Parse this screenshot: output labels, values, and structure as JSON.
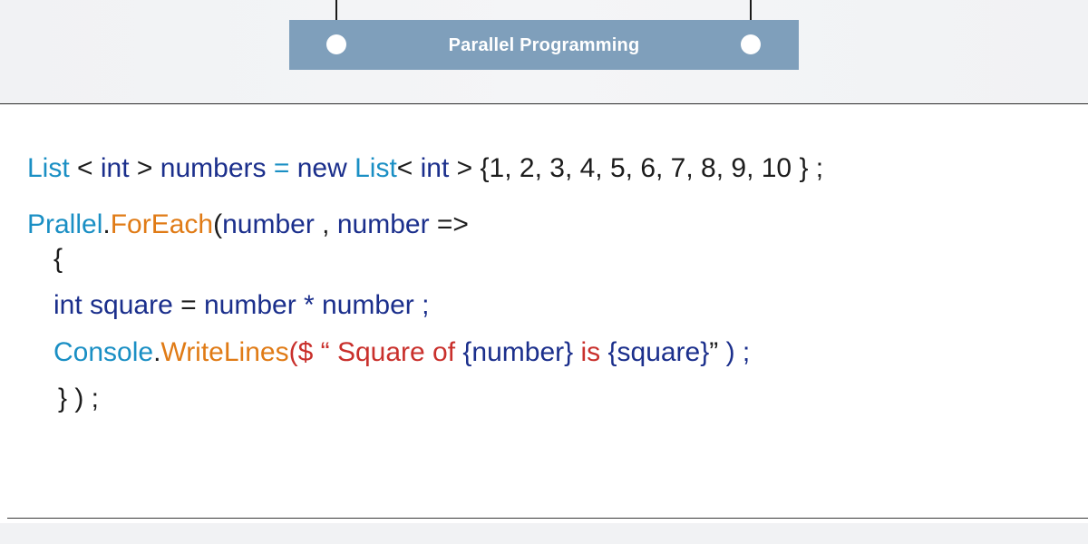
{
  "header": {
    "title": "Parallel Programming"
  },
  "code": {
    "line1": {
      "t1": "List",
      "t2": " < ",
      "t3": "int",
      "t4": " > ",
      "t5": "numbers",
      "t6": " = ",
      "t7": "new",
      "t8": " ",
      "t9": "List",
      "t10": "< ",
      "t11": "int",
      "t12": " > ",
      "t13": "{1, 2, 3, 4, 5, 6, 7, 8, 9, 10 }",
      "t14": " ;"
    },
    "line2": {
      "t1": "Prallel",
      "t2": ".",
      "t3": "ForEach",
      "t4": "(",
      "t5": "number",
      "t6": " , ",
      "t7": "number",
      "t8": " =>"
    },
    "line3": {
      "t1": "{"
    },
    "line4": {
      "t1": "int",
      "t2": " ",
      "t3": "square",
      "t4": " = ",
      "t5": "number",
      "t6": " * ",
      "t7": "number",
      "t8": " ;"
    },
    "line5": {
      "t1": "Console",
      "t2": ".",
      "t3": "WriteLines",
      "t4": "($",
      "t5": " “ Square of ",
      "t6": "{number}",
      "t7": " is ",
      "t8": "{square}",
      "t9": "” ",
      "t10": ") ;"
    },
    "line6": {
      "t1": "} ) ;"
    }
  }
}
